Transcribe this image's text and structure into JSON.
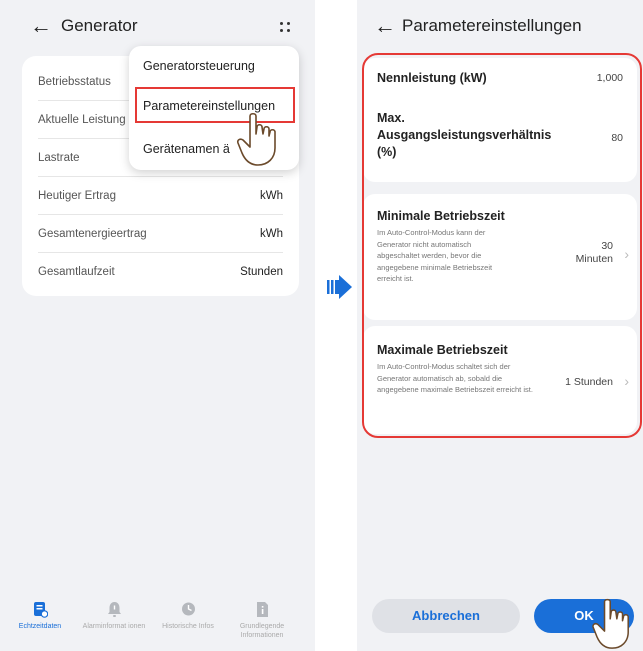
{
  "left": {
    "title": "Generator",
    "status_rows": [
      {
        "label": "Betriebsstatus",
        "value": ""
      },
      {
        "label": "Aktuelle Leistung",
        "value": ""
      },
      {
        "label": "Lastrate",
        "value": ""
      },
      {
        "label": "Heutiger Ertrag",
        "value": "kWh"
      },
      {
        "label": "Gesamtenergieertrag",
        "value": "kWh"
      },
      {
        "label": "Gesamtlaufzeit",
        "value": "Stunden"
      }
    ],
    "menu": {
      "items": [
        "Generatorsteuerung",
        "Parametereinstellungen",
        "Gerätenamen ä"
      ],
      "highlighted": "Parametereinstellungen"
    },
    "tabs": [
      {
        "label": "Echtzeitdaten",
        "icon": "realtime-data-icon",
        "active": true
      },
      {
        "label": "Alarminformat ionen",
        "icon": "alarm-bell-icon",
        "active": false
      },
      {
        "label": "Historische Infos",
        "icon": "history-icon",
        "active": false
      },
      {
        "label": "Grundlegende Informationen",
        "icon": "info-document-icon",
        "active": false
      }
    ]
  },
  "right": {
    "title": "Parametereinstellungen",
    "params": {
      "rated_power": {
        "label": "Nennleistung (kW)",
        "value": "1,000"
      },
      "max_ratio": {
        "label": "Max. Ausgangsleistungsverhältnis (%)",
        "value": "80"
      },
      "min_runtime": {
        "label": "Minimale Betriebszeit",
        "desc": "Im Auto-Control-Modus kann der Generator nicht automatisch abgeschaltet werden, bevor die angegebene minimale Betriebszeit erreicht ist.",
        "value": "30 Minuten"
      },
      "max_runtime": {
        "label": "Maximale Betriebszeit",
        "desc": "Im Auto-Control-Modus schaltet sich der Generator automatisch ab, sobald die angegebene maximale Betriebszeit erreicht ist.",
        "value": "1 Stunden"
      }
    },
    "buttons": {
      "cancel": "Abbrechen",
      "ok": "OK"
    }
  },
  "colors": {
    "accent": "#1a6fd8",
    "highlight": "#e53935",
    "background": "#f1f2f5"
  }
}
